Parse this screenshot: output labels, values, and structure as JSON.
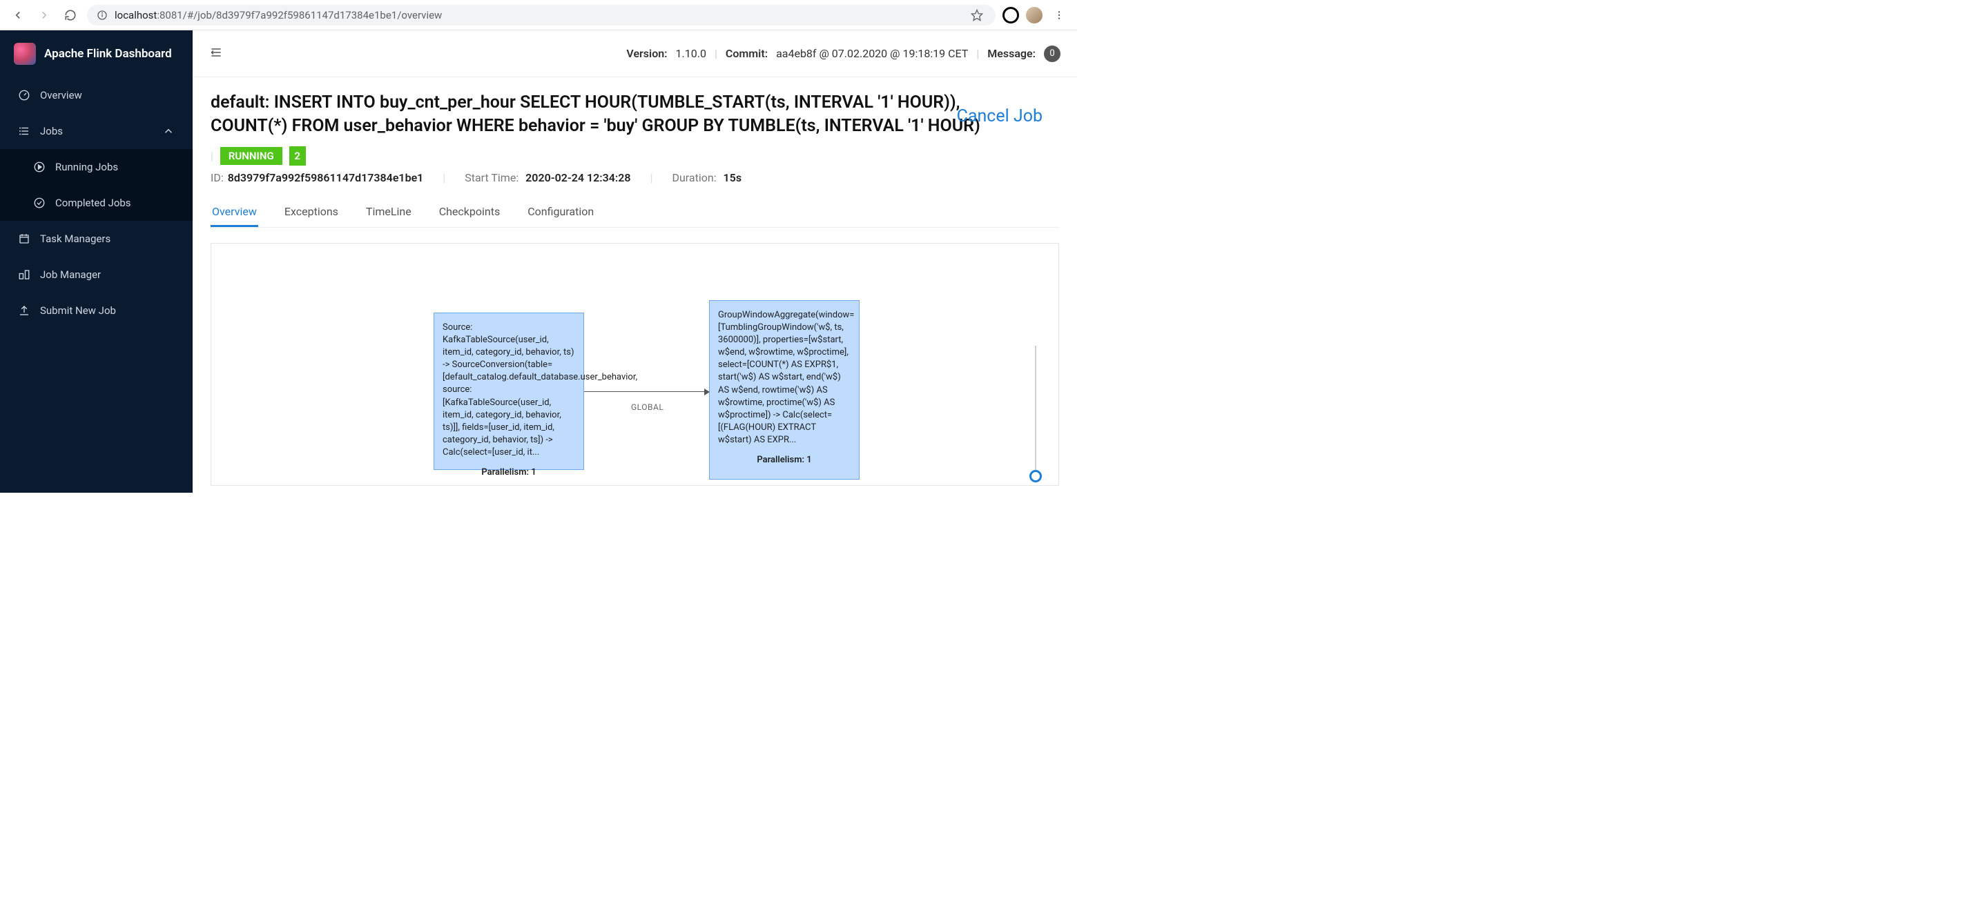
{
  "browser": {
    "url_host": "localhost",
    "url_port_path": ":8081/#/job/8d3979f7a992f59861147d17384e1be1/overview"
  },
  "app_title": "Apache Flink Dashboard",
  "sidebar": {
    "items": [
      {
        "label": "Overview"
      },
      {
        "label": "Jobs"
      },
      {
        "label": "Running Jobs"
      },
      {
        "label": "Completed Jobs"
      },
      {
        "label": "Task Managers"
      },
      {
        "label": "Job Manager"
      },
      {
        "label": "Submit New Job"
      }
    ]
  },
  "topbar": {
    "version_label": "Version:",
    "version": "1.10.0",
    "commit_label": "Commit:",
    "commit": "aa4eb8f @ 07.02.2020 @ 19:18:19 CET",
    "message_label": "Message:",
    "message_count": "0"
  },
  "job": {
    "title": "default: INSERT INTO buy_cnt_per_hour SELECT HOUR(TUMBLE_START(ts, INTERVAL '1' HOUR)), COUNT(*) FROM user_behavior WHERE behavior = 'buy' GROUP BY TUMBLE(ts, INTERVAL '1' HOUR)",
    "cancel_label": "Cancel Job",
    "status": "RUNNING",
    "count": "2",
    "id_label": "ID:",
    "id": "8d3979f7a992f59861147d17384e1be1",
    "start_label": "Start Time:",
    "start": "2020-02-24 12:34:28",
    "duration_label": "Duration:",
    "duration": "15s"
  },
  "tabs": [
    {
      "label": "Overview"
    },
    {
      "label": "Exceptions"
    },
    {
      "label": "TimeLine"
    },
    {
      "label": "Checkpoints"
    },
    {
      "label": "Configuration"
    }
  ],
  "graph": {
    "node1": {
      "text": "Source: KafkaTableSource(user_id, item_id, category_id, behavior, ts) -> SourceConversion(table=[default_catalog.default_database.user_behavior, source: [KafkaTableSource(user_id, item_id, category_id, behavior, ts)]], fields=[user_id, item_id, category_id, behavior, ts]) -> Calc(select=[user_id, it...",
      "parallelism": "Parallelism: 1"
    },
    "node2": {
      "text": "GroupWindowAggregate(window=[TumblingGroupWindow('w$, ts, 3600000)], properties=[w$start, w$end, w$rowtime, w$proctime], select=[COUNT(*) AS EXPR$1, start('w$) AS w$start, end('w$) AS w$end, rowtime('w$) AS w$rowtime, proctime('w$) AS w$proctime]) -> Calc(select=[(FLAG(HOUR) EXTRACT w$start) AS EXPR...",
      "parallelism": "Parallelism: 1"
    },
    "edge_label": "GLOBAL"
  }
}
